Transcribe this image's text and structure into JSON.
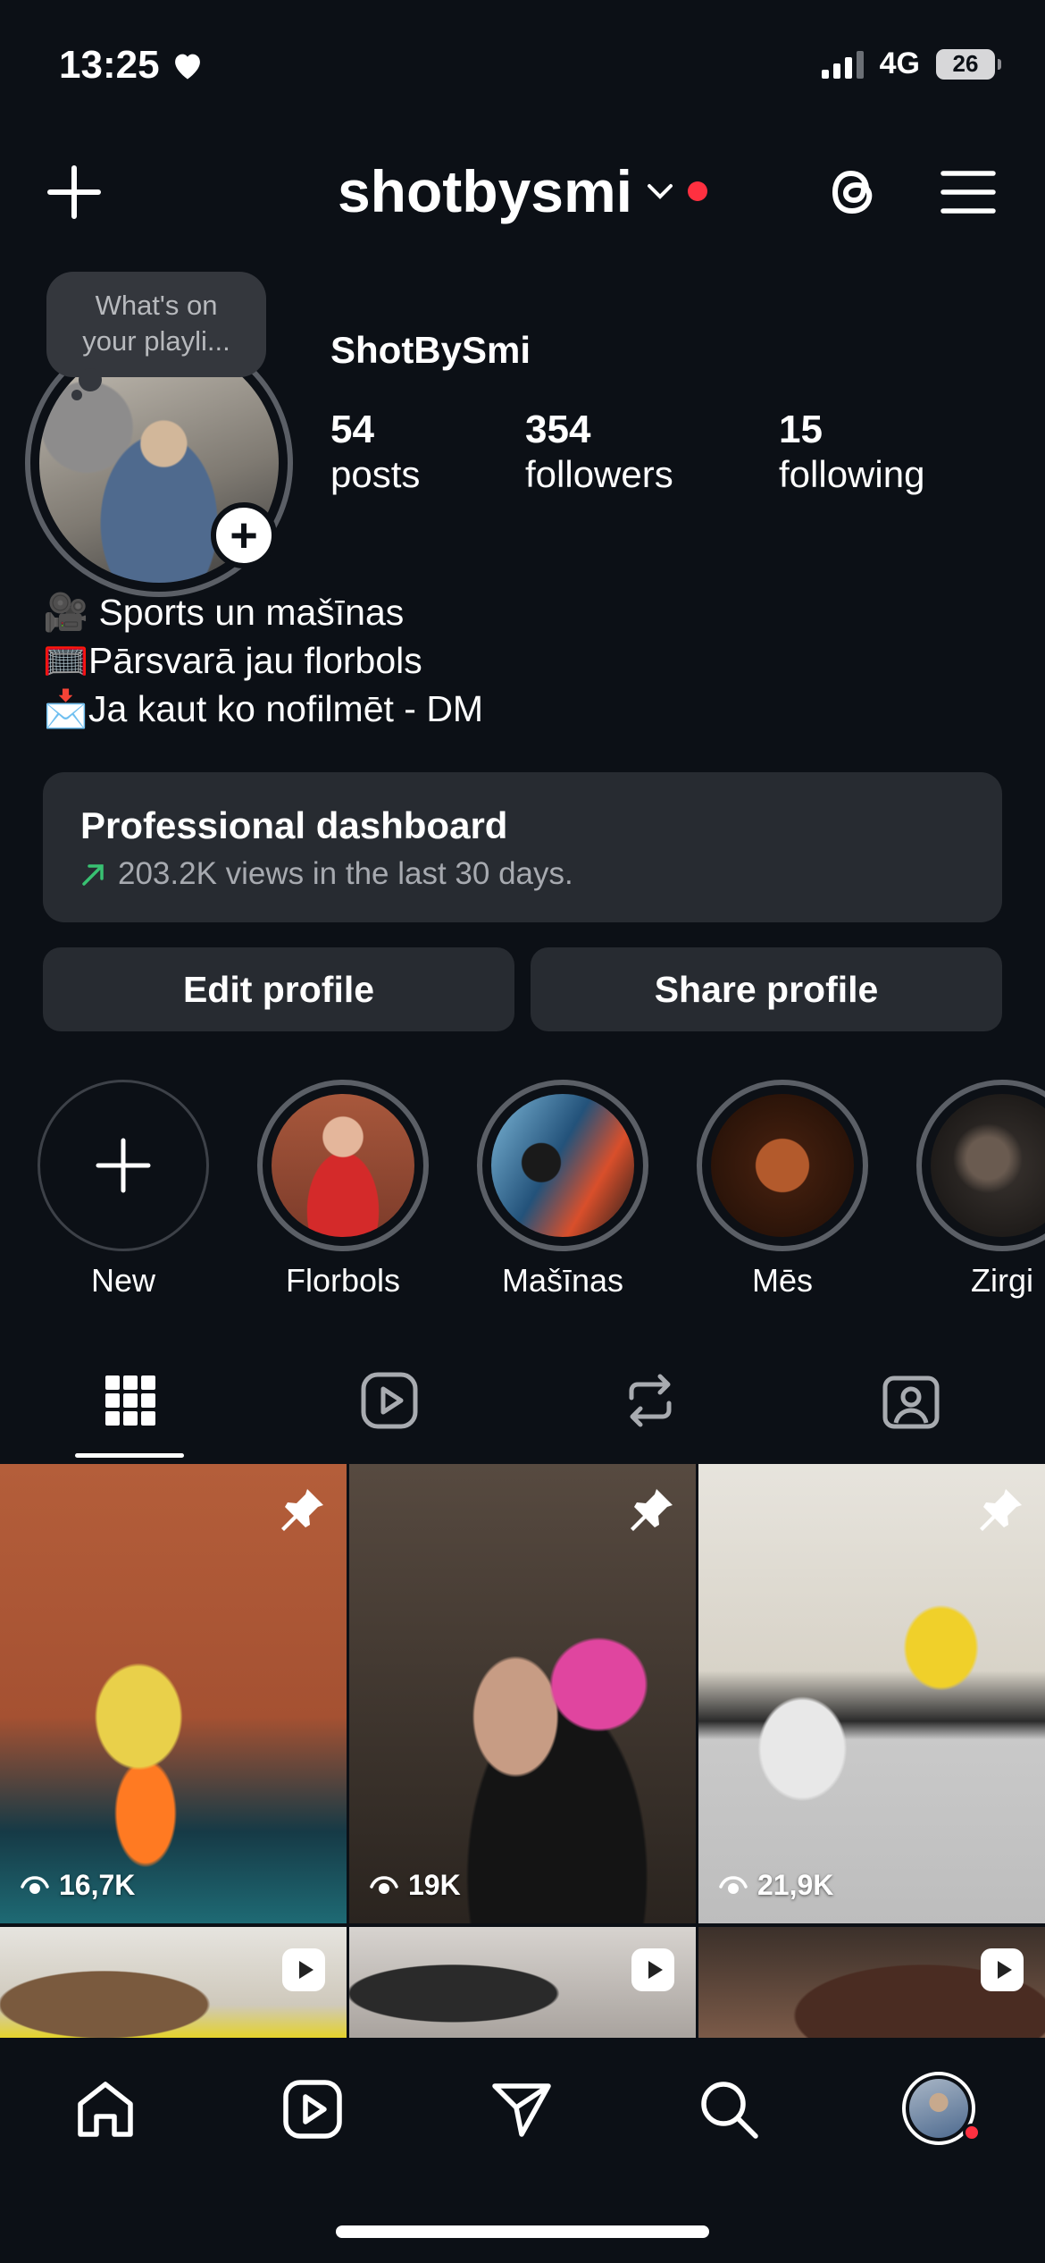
{
  "status_bar": {
    "time": "13:25",
    "network": "4G",
    "battery": "26"
  },
  "header": {
    "username": "shotbysmi"
  },
  "note": {
    "text_line1": "What's on",
    "text_line2": "your playli..."
  },
  "profile": {
    "display_name": "ShotBySmi",
    "stats": [
      {
        "value": "54",
        "label": "posts"
      },
      {
        "value": "354",
        "label": "followers"
      },
      {
        "value": "15",
        "label": "following"
      }
    ],
    "bio": [
      "🎥 Sports un mašīnas",
      "🥅Pārsvarā jau florbols",
      "📩Ja kaut ko nofilmēt - DM"
    ]
  },
  "dashboard": {
    "title": "Professional dashboard",
    "subtitle": "203.2K views in the last 30 days."
  },
  "buttons": {
    "edit": "Edit profile",
    "share": "Share profile"
  },
  "highlights": [
    {
      "label": "New"
    },
    {
      "label": "Florbols"
    },
    {
      "label": "Mašīnas"
    },
    {
      "label": "Mēs"
    },
    {
      "label": "Zirgi"
    }
  ],
  "posts": [
    {
      "views": "16,7K",
      "pinned": true
    },
    {
      "views": "19K",
      "pinned": true
    },
    {
      "views": "21,9K",
      "pinned": true
    },
    {
      "type": "reel"
    },
    {
      "type": "reel"
    },
    {
      "type": "reel"
    }
  ],
  "colors": {
    "background": "#0c1016",
    "surface": "#272b31",
    "accent_red": "#ff3040",
    "trend_green": "#38c172"
  }
}
